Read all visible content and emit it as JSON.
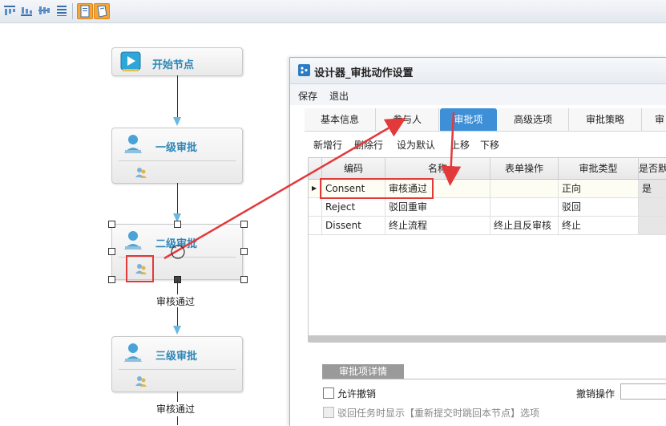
{
  "flow": {
    "nodes": [
      {
        "title": "开始节点"
      },
      {
        "title": "一级审批"
      },
      {
        "title": "二级审批"
      },
      {
        "title": "三级审批"
      }
    ],
    "edge_labels": [
      "审核通过",
      "审核通过"
    ]
  },
  "dialog": {
    "title": "设计器_审批动作设置",
    "menu": [
      "保存",
      "退出"
    ],
    "tabs": [
      "基本信息",
      "参与人",
      "审批项",
      "高级选项",
      "审批策略",
      "审"
    ],
    "active_tab": "审批项",
    "grid_toolbar": [
      "新增行",
      "删除行",
      "设为默认",
      "上移",
      "下移"
    ],
    "grid": {
      "columns": [
        "编码",
        "名称",
        "表单操作",
        "审批类型",
        "是否默"
      ],
      "rows": [
        {
          "code": "Consent",
          "name": "审核通过",
          "form_op": "",
          "type": "正向",
          "default": "是"
        },
        {
          "code": "Reject",
          "name": "驳回重审",
          "form_op": "",
          "type": "驳回",
          "default": ""
        },
        {
          "code": "Dissent",
          "name": "终止流程",
          "form_op": "终止且反审核",
          "type": "终止",
          "default": ""
        }
      ]
    },
    "detail": {
      "tab_label": "审批项详情",
      "allow_cancel_label": "允许撤销",
      "cancel_op_label": "撤销操作",
      "reject_option_label": "驳回任务时显示【重新提交时跳回本节点】选项"
    }
  },
  "colors": {
    "accent": "#3d8fd8",
    "annotation": "#e23a3a",
    "node_title": "#2c86b8"
  }
}
